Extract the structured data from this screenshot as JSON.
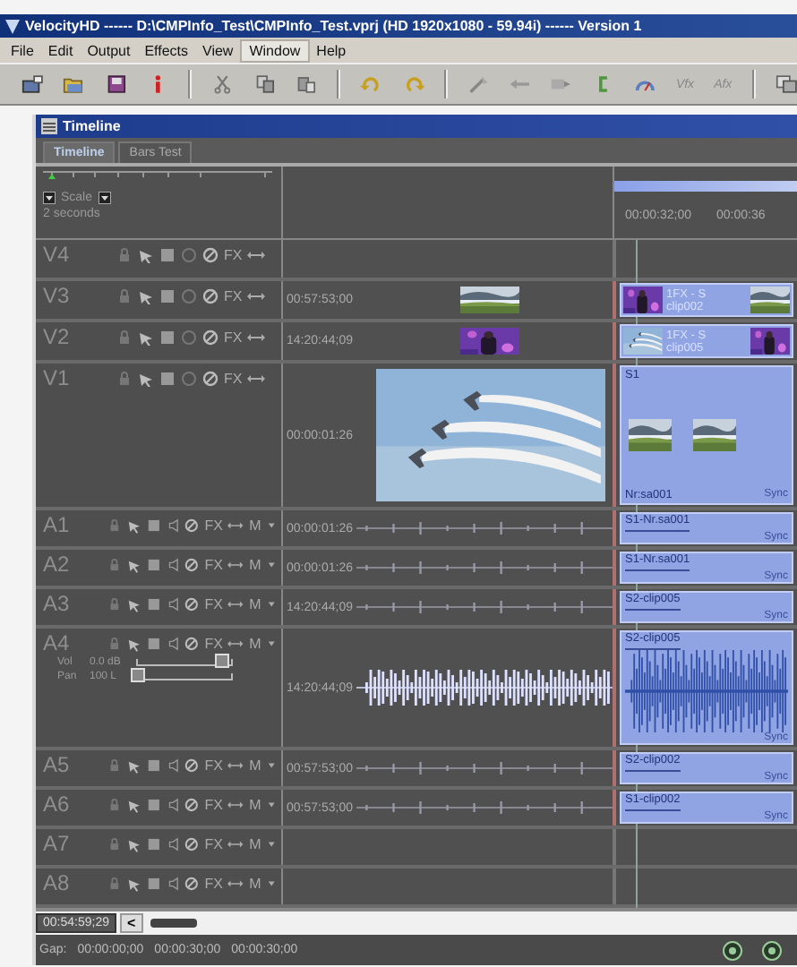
{
  "window": {
    "title": "VelocityHD ------ D:\\CMPInfo_Test\\CMPInfo_Test.vprj (HD 1920x1080 - 59.94i) ------ Version 1"
  },
  "menu": [
    {
      "label": "File",
      "selected": false
    },
    {
      "label": "Edit",
      "selected": false
    },
    {
      "label": "Output",
      "selected": false
    },
    {
      "label": "Effects",
      "selected": false
    },
    {
      "label": "View",
      "selected": false
    },
    {
      "label": "Window",
      "selected": true
    },
    {
      "label": "Help",
      "selected": false
    }
  ],
  "toolbar": [
    {
      "kind": "icon"
    },
    {
      "kind": "icon"
    },
    {
      "kind": "icon"
    },
    {
      "kind": "icon"
    },
    {
      "kind": "separator"
    },
    {
      "kind": "icon"
    },
    {
      "kind": "icon"
    },
    {
      "kind": "icon"
    },
    {
      "kind": "separator"
    },
    {
      "kind": "icon"
    },
    {
      "kind": "icon"
    },
    {
      "kind": "separator"
    },
    {
      "kind": "icon"
    },
    {
      "kind": "icon"
    },
    {
      "kind": "icon"
    },
    {
      "kind": "icon"
    },
    {
      "kind": "icon"
    },
    {
      "kind": "text",
      "label": "Vfx"
    },
    {
      "kind": "text",
      "label": "Afx"
    },
    {
      "kind": "separator"
    },
    {
      "kind": "icon"
    }
  ],
  "timeline": {
    "title": "Timeline",
    "tabs": [
      {
        "label": "Timeline",
        "selected": true
      },
      {
        "label": "Bars Test",
        "selected": false
      }
    ],
    "scale": {
      "label": "Scale",
      "unit": "2 seconds"
    },
    "ruler": [
      "00:00:32;00",
      "00:00:36"
    ],
    "tracks": [
      {
        "name": "V4",
        "kind": "video",
        "expanded": false,
        "fx": "FX"
      },
      {
        "name": "V3",
        "kind": "video",
        "expanded": false,
        "fx": "FX",
        "source": {
          "timecode": "00:57:53;00"
        },
        "clip": {
          "title": "1FX - S",
          "subtitle": "clip002"
        }
      },
      {
        "name": "V2",
        "kind": "video",
        "expanded": false,
        "fx": "FX",
        "source": {
          "timecode": "14:20:44;09"
        },
        "clip": {
          "title": "1FX - S",
          "subtitle": "clip005"
        }
      },
      {
        "name": "V1",
        "kind": "video",
        "expanded": true,
        "fx": "FX",
        "source": {
          "timecode": "00:00:01:26"
        },
        "clip": {
          "title": "S1",
          "subtitle": "Nr:sa001",
          "sync": "Sync"
        }
      },
      {
        "name": "A1",
        "kind": "audio",
        "expanded": false,
        "fx": "FX",
        "mode": "M",
        "source": {
          "timecode": "00:00:01:26"
        },
        "clip": {
          "title": "S1-Nr.sa001",
          "sync": "Sync"
        }
      },
      {
        "name": "A2",
        "kind": "audio",
        "expanded": false,
        "fx": "FX",
        "mode": "M",
        "source": {
          "timecode": "00:00:01:26"
        },
        "clip": {
          "title": "S1-Nr.sa001",
          "sync": "Sync"
        }
      },
      {
        "name": "A3",
        "kind": "audio",
        "expanded": false,
        "fx": "FX",
        "mode": "M",
        "source": {
          "timecode": "14:20:44;09"
        },
        "clip": {
          "title": "S2-clip005",
          "sync": "Sync"
        }
      },
      {
        "name": "A4",
        "kind": "audio",
        "expanded": true,
        "fx": "FX",
        "mode": "M",
        "volume": {
          "label": "Vol",
          "reading": "0.0 dB",
          "level": 0.9
        },
        "pan": {
          "label": "Pan",
          "reading": "100 L",
          "level": 0.0
        },
        "source": {
          "timecode": "14:20:44;09"
        },
        "clip": {
          "title": "S2-clip005",
          "sync": "Sync"
        }
      },
      {
        "name": "A5",
        "kind": "audio",
        "expanded": false,
        "fx": "FX",
        "mode": "M",
        "source": {
          "timecode": "00:57:53;00"
        },
        "clip": {
          "title": "S2-clip002",
          "sync": "Sync"
        }
      },
      {
        "name": "A6",
        "kind": "audio",
        "expanded": false,
        "fx": "FX",
        "mode": "M",
        "source": {
          "timecode": "00:57:53;00"
        },
        "clip": {
          "title": "S1-clip002",
          "sync": "Sync"
        }
      },
      {
        "name": "A7",
        "kind": "audio",
        "expanded": false,
        "fx": "FX",
        "mode": "M"
      },
      {
        "name": "A8",
        "kind": "audio",
        "expanded": false,
        "fx": "FX",
        "mode": "M"
      }
    ],
    "position": "00:54:59;29",
    "scroll_back": "<",
    "gap": {
      "label": "Gap:",
      "values": [
        "00:00:00;00",
        "00:00:30;00",
        "00:00:30;00"
      ]
    }
  }
}
